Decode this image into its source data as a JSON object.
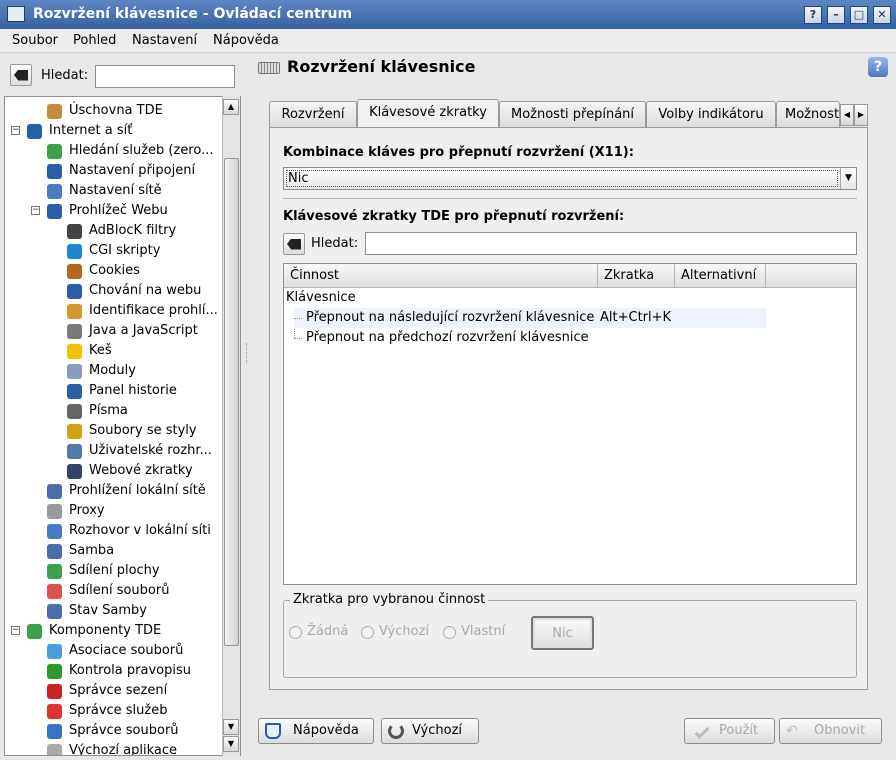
{
  "window": {
    "title": "Rozvržení klávesnice - Ovládací centrum",
    "buttons": {
      "help": "?",
      "minimize": "–",
      "maximize": "□",
      "close": "✕"
    }
  },
  "menubar": {
    "items": [
      "Soubor",
      "Pohled",
      "Nastavení",
      "Nápověda"
    ]
  },
  "sidebar": {
    "search_label": "Hledat:",
    "search_value": "",
    "tree": [
      {
        "label": "Úschovna TDE",
        "level": 1,
        "icon": "archive-icon",
        "color": "#c58a3a"
      },
      {
        "label": "Internet a síť",
        "level": 0,
        "icon": "globe-icon",
        "color": "#2a5fa8",
        "expanded": true
      },
      {
        "label": "Hledání služeb (zero...",
        "level": 1,
        "icon": "service-discovery-icon",
        "color": "#3aa34a"
      },
      {
        "label": "Nastavení připojení",
        "level": 1,
        "icon": "connection-icon",
        "color": "#2a5fa8"
      },
      {
        "label": "Nastavení sítě",
        "level": 1,
        "icon": "network-icon",
        "color": "#4a7cc2"
      },
      {
        "label": "Prohlížeč Webu",
        "level": 1,
        "icon": "web-browser-icon",
        "color": "#2a5fa8",
        "expanded": true
      },
      {
        "label": "AdBlocK filtry",
        "level": 2,
        "icon": "filter-icon",
        "color": "#444444"
      },
      {
        "label": "CGI skripty",
        "level": 2,
        "icon": "gear-icon",
        "color": "#1e88d4"
      },
      {
        "label": "Cookies",
        "level": 2,
        "icon": "cookie-icon",
        "color": "#b5651d"
      },
      {
        "label": "Chování na webu",
        "level": 2,
        "icon": "globe-icon",
        "color": "#2a5fa8"
      },
      {
        "label": "Identifikace prohlí...",
        "level": 2,
        "icon": "warning-icon",
        "color": "#d9962b"
      },
      {
        "label": "Java a JavaScript",
        "level": 2,
        "icon": "java-icon",
        "color": "#7a7a7a"
      },
      {
        "label": "Keš",
        "level": 2,
        "icon": "cache-icon",
        "color": "#f2c200"
      },
      {
        "label": "Moduly",
        "level": 2,
        "icon": "plugin-icon",
        "color": "#8a9bbf"
      },
      {
        "label": "Panel historie",
        "level": 2,
        "icon": "clock-icon",
        "color": "#2a5fa8"
      },
      {
        "label": "Písma",
        "level": 2,
        "icon": "font-icon",
        "color": "#666666"
      },
      {
        "label": "Soubory se styly",
        "level": 2,
        "icon": "css-icon",
        "color": "#d4a017"
      },
      {
        "label": "Uživatelské rozhr...",
        "level": 2,
        "icon": "ui-icon",
        "color": "#5577aa"
      },
      {
        "label": "Webové zkratky",
        "level": 2,
        "icon": "shortcut-icon",
        "color": "#33446a"
      },
      {
        "label": "Prohlížení lokální sítě",
        "level": 1,
        "icon": "monitor-icon",
        "color": "#4a6fa8"
      },
      {
        "label": "Proxy",
        "level": 1,
        "icon": "proxy-icon",
        "color": "#9a9a9a"
      },
      {
        "label": "Rozhovor v lokální síti",
        "level": 1,
        "icon": "chat-icon",
        "color": "#4a7cc2"
      },
      {
        "label": "Samba",
        "level": 1,
        "icon": "monitor-icon",
        "color": "#4a6fa8"
      },
      {
        "label": "Sdílení plochy",
        "level": 1,
        "icon": "desktop-share-icon",
        "color": "#3aa34a"
      },
      {
        "label": "Sdílení souborů",
        "level": 1,
        "icon": "file-share-icon",
        "color": "#d9534f"
      },
      {
        "label": "Stav Samby",
        "level": 1,
        "icon": "monitor-icon",
        "color": "#4a6fa8"
      },
      {
        "label": "Komponenty TDE",
        "level": 0,
        "icon": "components-icon",
        "color": "#3aa34a",
        "expanded": true
      },
      {
        "label": "Asociace souborů",
        "level": 1,
        "icon": "speech-bubble-icon",
        "color": "#4a9fd8"
      },
      {
        "label": "Kontrola pravopisu",
        "level": 1,
        "icon": "spellcheck-icon",
        "color": "#2e9a2e"
      },
      {
        "label": "Správce sezení",
        "level": 1,
        "icon": "power-icon",
        "color": "#cc2222"
      },
      {
        "label": "Správce služeb",
        "level": 1,
        "icon": "pin-icon",
        "color": "#dd3333"
      },
      {
        "label": "Správce souborů",
        "level": 1,
        "icon": "cube-icon",
        "color": "#3a72c8"
      },
      {
        "label": "Výchozí aplikace",
        "level": 1,
        "icon": "window-icon",
        "color": "#aaaaaa"
      }
    ]
  },
  "page": {
    "title": "Rozvržení klávesnice",
    "help_icon": "help-icon"
  },
  "tabs": [
    {
      "label": "Rozvržení",
      "active": false
    },
    {
      "label": "Klávesové zkratky",
      "active": true
    },
    {
      "label": "Možnosti přepínání",
      "active": false
    },
    {
      "label": "Volby indikátoru",
      "active": false
    },
    {
      "label": "Možnost",
      "active": false
    }
  ],
  "shortcuts_tab": {
    "combo_label": "Kombinace kláves pro přepnutí rozvržení (X11):",
    "combo_value": "Nic",
    "tde_label": "Klávesové zkratky TDE pro přepnutí rozvržení:",
    "search_label": "Hledat:",
    "search_value": "",
    "columns": [
      "Činnost",
      "Zkratka",
      "Alternativní"
    ],
    "group": "Klávesnice",
    "rows": [
      {
        "action": "Přepnout na následující rozvržení klávesnice",
        "shortcut": "Alt+Ctrl+K",
        "alternative": "",
        "selected": true
      },
      {
        "action": "Přepnout na předchozí rozvržení klávesnice",
        "shortcut": "",
        "alternative": "",
        "selected": false
      }
    ],
    "groupbox_title": "Zkratka pro vybranou činnost",
    "radio_none": "Žádná",
    "radio_default": "Výchozí",
    "radio_custom": "Vlastní",
    "shortcut_button": "Nic"
  },
  "bottom_buttons": {
    "help": "Nápověda",
    "defaults": "Výchozí",
    "apply": "Použít",
    "reset": "Obnovit"
  }
}
